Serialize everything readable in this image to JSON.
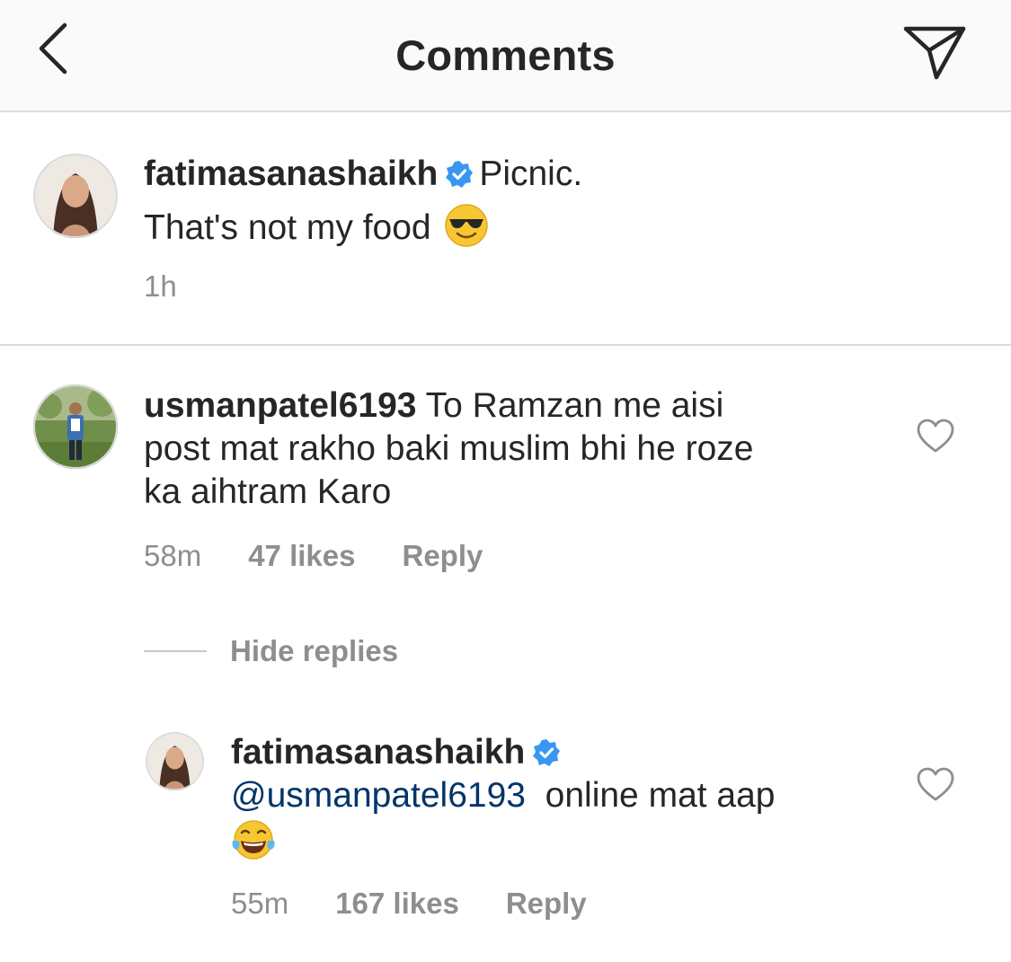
{
  "header": {
    "title": "Comments",
    "back_icon": "chevron-left-icon",
    "send_icon": "direct-send-icon"
  },
  "caption": {
    "username": "fatimasanashaikh",
    "verified": true,
    "line1": "Picnic.",
    "line2": "That's not my food",
    "emoji": "smiling-face-with-sunglasses",
    "time": "1h"
  },
  "comment": {
    "username": "usmanpatel6193",
    "text_line1": "To Ramzan me aisi",
    "text_line2": "post mat rakho baki muslim bhi he roze",
    "text_line3": "ka aihtram Karo",
    "time": "58m",
    "likes": "47 likes",
    "reply": "Reply"
  },
  "replies_toggle": "Hide replies",
  "reply": {
    "username": "fatimasanashaikh",
    "verified": true,
    "mention": "@usmanpatel6193",
    "text": "online mat aap",
    "emoji": "face-with-tears-of-joy",
    "time": "55m",
    "likes": "167 likes",
    "reply": "Reply"
  },
  "colors": {
    "verified_blue": "#3897f0",
    "mention_blue": "#003569",
    "secondary_text": "#8e8e8e",
    "divider": "#dbdbdb"
  }
}
